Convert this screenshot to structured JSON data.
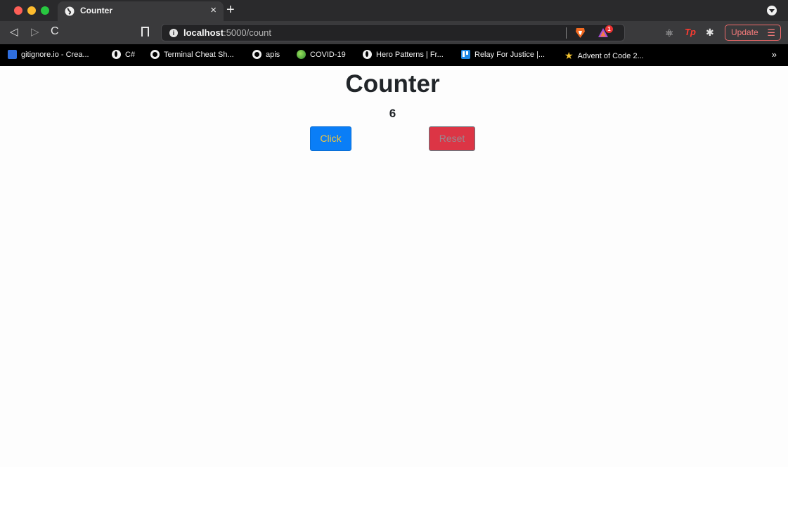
{
  "browser": {
    "tab": {
      "title": "Counter",
      "close": "×"
    },
    "new_tab": "+",
    "nav": {
      "back": "◁",
      "forward": "▷",
      "reload": "C"
    },
    "url": {
      "host": "localhost",
      "path": ":5000/count"
    },
    "rewards_badge": "1",
    "update_label": "Update",
    "update_menu": "☰",
    "bookmarks": [
      {
        "label": "gitignore.io - Crea...",
        "icon": "gitignore-icon"
      },
      {
        "label": "C#",
        "icon": "globe-icon"
      },
      {
        "label": "Terminal Cheat Sh...",
        "icon": "github-icon"
      },
      {
        "label": "apis",
        "icon": "github-icon"
      },
      {
        "label": "COVID-19",
        "icon": "covid-icon"
      },
      {
        "label": "Hero Patterns | Fr...",
        "icon": "globe-icon"
      },
      {
        "label": "Relay For Justice |...",
        "icon": "trello-icon"
      },
      {
        "label": "Advent of Code 2...",
        "icon": "star-icon"
      }
    ],
    "bookmarks_more": "»"
  },
  "page": {
    "title": "Counter",
    "count": "6",
    "click_label": "Click",
    "reset_label": "Reset"
  },
  "colors": {
    "click_button": "#0a7ef7",
    "reset_button": "#dc3545"
  }
}
